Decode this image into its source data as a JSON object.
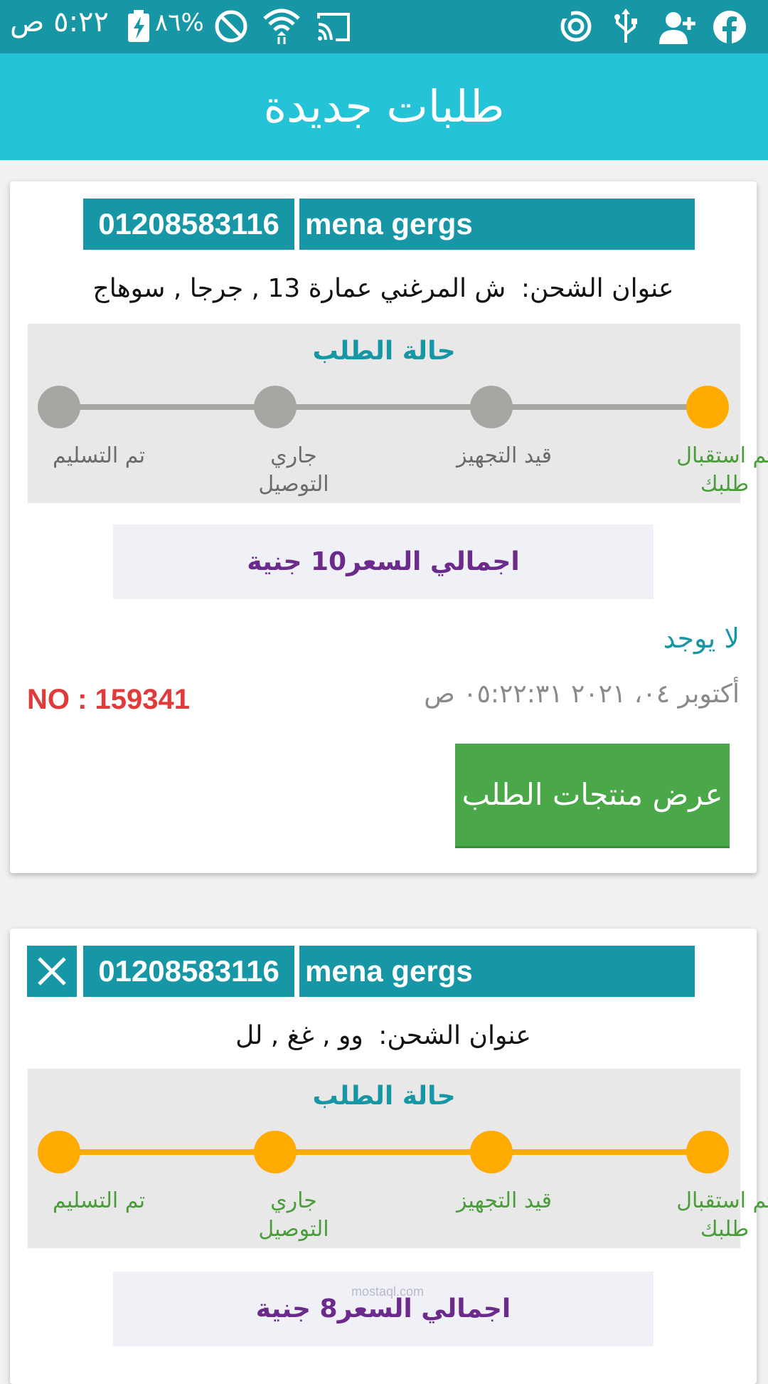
{
  "status_bar": {
    "time": "٥:٢٢ ص",
    "battery": "%٨٦",
    "icons": [
      "battery-charging-icon",
      "do-not-disturb-icon",
      "wifi-icon",
      "cast-icon",
      "sync-icon",
      "usb-icon",
      "add-user-icon",
      "facebook-icon"
    ]
  },
  "app_bar": {
    "title": "طلبات جديدة"
  },
  "orders": [
    {
      "customer_name": "mena gergs",
      "phone": "01208583116",
      "address_label": "عنوان الشحن:",
      "address_value": "ش المرغني عمارة 13 , جرجا , سوهاج",
      "status_title": "حالة الطلب",
      "steps": [
        {
          "label": "تم استقبال طلبك",
          "active": true
        },
        {
          "label": "قيد التجهيز",
          "active": false
        },
        {
          "label": "جاري التوصيل",
          "active": false
        },
        {
          "label": "تم التسليم",
          "active": false
        }
      ],
      "total": "اجمالي السعر10 جنية",
      "notes": "لا يوجد",
      "date": "أكتوبر ٠٤، ٢٠٢١ ٠٥:٢٢:٣١ ص",
      "order_no": "NO : 159341",
      "products_button": "عرض منتجات الطلب"
    },
    {
      "customer_name": "mena gergs",
      "phone": "01208583116",
      "address_label": "عنوان الشحن:",
      "address_value": "وو , غغ , لل",
      "status_title": "حالة الطلب",
      "steps": [
        {
          "label": "تم استقبال طلبك",
          "active": true
        },
        {
          "label": "قيد التجهيز",
          "active": true
        },
        {
          "label": "جاري التوصيل",
          "active": true
        },
        {
          "label": "تم التسليم",
          "active": true
        }
      ],
      "total": "اجمالي السعر8 جنية"
    }
  ],
  "watermark": "mostaql.com",
  "colors": {
    "status_bar": "#1797a6",
    "app_bar": "#24c3d7",
    "step_active": "#ffab00",
    "step_inactive": "#a8a6a2",
    "label_active": "#4a9e3a",
    "label_inactive": "#6b6b6b",
    "order_no": "#e03a3a",
    "total_text": "#6b2a8c",
    "button": "#4aa849"
  }
}
